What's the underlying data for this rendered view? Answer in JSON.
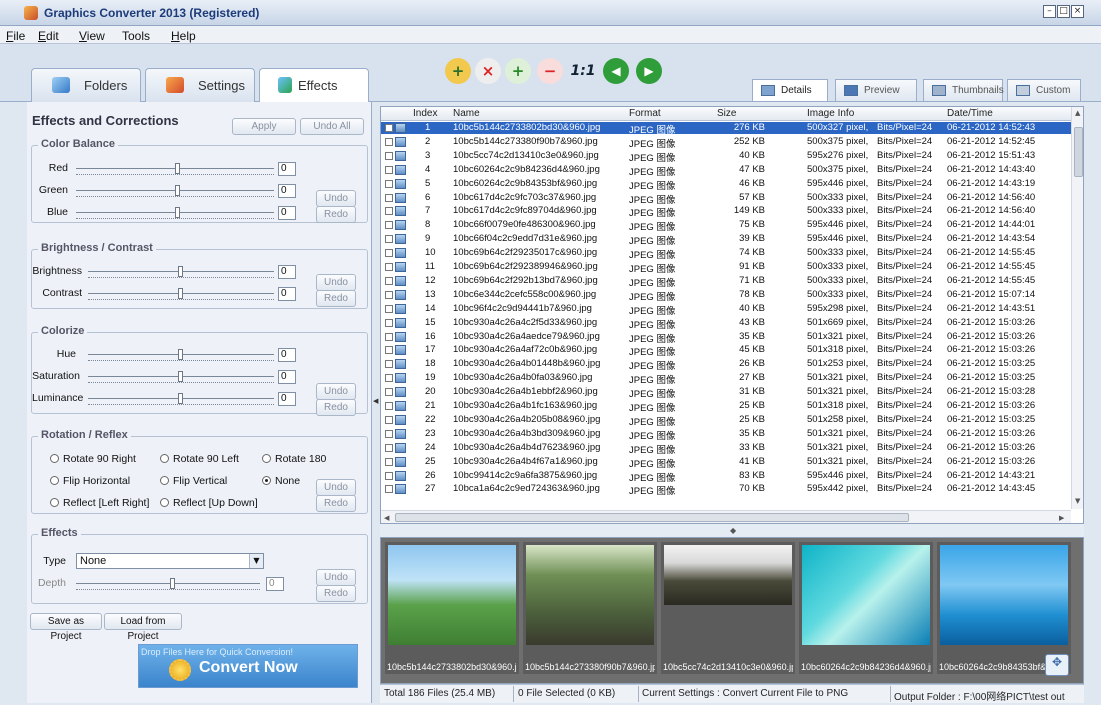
{
  "window": {
    "title": "Graphics Converter 2013  (Registered)"
  },
  "menu": [
    {
      "label": "File",
      "ul": "F",
      "rest": "ile"
    },
    {
      "label": "Edit",
      "ul": "E",
      "rest": "dit"
    },
    {
      "label": "View",
      "ul": "V",
      "rest": "iew"
    },
    {
      "label": "Tools",
      "ul": "",
      "rest": "Tools"
    },
    {
      "label": "Help",
      "ul": "H",
      "rest": "elp"
    }
  ],
  "main_tabs": [
    "Folders",
    "Settings",
    "Effects"
  ],
  "toolbar": {
    "one_to_one": "1:1"
  },
  "view_tabs": [
    "Details",
    "Preview",
    "Thumbnails",
    "Custom"
  ],
  "panel": {
    "title": "Effects and Corrections",
    "apply": "Apply",
    "undo_all": "Undo All",
    "undo": "Undo",
    "redo": "Redo",
    "color_balance": {
      "title": "Color Balance",
      "red": "Red",
      "green": "Green",
      "blue": "Blue",
      "red_value": "0",
      "green_value": "0",
      "blue_value": "0"
    },
    "brightness": {
      "title": "Brightness / Contrast",
      "brightness": "Brightness",
      "contrast": "Contrast",
      "brightness_value": "0",
      "contrast_value": "0"
    },
    "colorize": {
      "title": "Colorize",
      "hue": "Hue",
      "saturation": "Saturation",
      "luminance": "Luminance",
      "hue_value": "0",
      "saturation_value": "0",
      "luminance_value": "0"
    },
    "rotation": {
      "title": "Rotation / Reflex",
      "options": [
        "Rotate 90 Right",
        "Rotate 90 Left",
        "Rotate 180",
        "Flip Horizontal",
        "Flip Vertical",
        "None",
        "Reflect [Left Right]",
        "Reflect [Up Down]"
      ],
      "selected": "None"
    },
    "effects": {
      "title": "Effects",
      "type_label": "Type",
      "type_value": "None",
      "depth_label": "Depth",
      "depth_value": "0"
    },
    "save_project": "Save as Project",
    "load_project": "Load from Project",
    "convert_hint": "Drop Files Here for Quick Conversion!",
    "convert_now": "Convert Now"
  },
  "file_list": {
    "columns": [
      "Index",
      "Name",
      "Format",
      "Size",
      "Image Info",
      "Date/Time"
    ],
    "rows": [
      [
        "1",
        "10bc5b144c2733802bd30&960.jpg",
        "JPEG 图像",
        "276 KB",
        "500x327 pixel,",
        "Bits/Pixel=24",
        "06-21-2012  14:52:43"
      ],
      [
        "2",
        "10bc5b144c273380f90b7&960.jpg",
        "JPEG 图像",
        "252 KB",
        "500x375 pixel,",
        "Bits/Pixel=24",
        "06-21-2012  14:52:45"
      ],
      [
        "3",
        "10bc5cc74c2d13410c3e0&960.jpg",
        "JPEG 图像",
        "40 KB",
        "595x276 pixel,",
        "Bits/Pixel=24",
        "06-21-2012  15:51:43"
      ],
      [
        "4",
        "10bc60264c2c9b84236d4&960.jpg",
        "JPEG 图像",
        "47 KB",
        "500x375 pixel,",
        "Bits/Pixel=24",
        "06-21-2012  14:43:40"
      ],
      [
        "5",
        "10bc60264c2c9b84353bf&960.jpg",
        "JPEG 图像",
        "46 KB",
        "595x446 pixel,",
        "Bits/Pixel=24",
        "06-21-2012  14:43:19"
      ],
      [
        "6",
        "10bc617d4c2c9fc703c37&960.jpg",
        "JPEG 图像",
        "57 KB",
        "500x333 pixel,",
        "Bits/Pixel=24",
        "06-21-2012  14:56:40"
      ],
      [
        "7",
        "10bc617d4c2c9fc89704d&960.jpg",
        "JPEG 图像",
        "149 KB",
        "500x333 pixel,",
        "Bits/Pixel=24",
        "06-21-2012  14:56:40"
      ],
      [
        "8",
        "10bc66f0079e0fe486300&960.jpg",
        "JPEG 图像",
        "75 KB",
        "595x446 pixel,",
        "Bits/Pixel=24",
        "06-21-2012  14:44:01"
      ],
      [
        "9",
        "10bc66f04c2c9edd7d31e&960.jpg",
        "JPEG 图像",
        "39 KB",
        "595x446 pixel,",
        "Bits/Pixel=24",
        "06-21-2012  14:43:54"
      ],
      [
        "10",
        "10bc69b64c2f29235017c&960.jpg",
        "JPEG 图像",
        "74 KB",
        "500x333 pixel,",
        "Bits/Pixel=24",
        "06-21-2012  14:55:45"
      ],
      [
        "11",
        "10bc69b64c2f292389946&960.jpg",
        "JPEG 图像",
        "91 KB",
        "500x333 pixel,",
        "Bits/Pixel=24",
        "06-21-2012  14:55:45"
      ],
      [
        "12",
        "10bc69b64c2f292b13bd7&960.jpg",
        "JPEG 图像",
        "71 KB",
        "500x333 pixel,",
        "Bits/Pixel=24",
        "06-21-2012  14:55:45"
      ],
      [
        "13",
        "10bc6e344c2cefc558c00&960.jpg",
        "JPEG 图像",
        "78 KB",
        "500x333 pixel,",
        "Bits/Pixel=24",
        "06-21-2012  15:07:14"
      ],
      [
        "14",
        "10bc96f4c2c9d94441b7&960.jpg",
        "JPEG 图像",
        "40 KB",
        "595x298 pixel,",
        "Bits/Pixel=24",
        "06-21-2012  14:43:51"
      ],
      [
        "15",
        "10bc930a4c26a4c2f5d33&960.jpg",
        "JPEG 图像",
        "43 KB",
        "501x669 pixel,",
        "Bits/Pixel=24",
        "06-21-2012  15:03:26"
      ],
      [
        "16",
        "10bc930a4c26a4aedce79&960.jpg",
        "JPEG 图像",
        "35 KB",
        "501x321 pixel,",
        "Bits/Pixel=24",
        "06-21-2012  15:03:26"
      ],
      [
        "17",
        "10bc930a4c26a4af72c0b&960.jpg",
        "JPEG 图像",
        "45 KB",
        "501x318 pixel,",
        "Bits/Pixel=24",
        "06-21-2012  15:03:26"
      ],
      [
        "18",
        "10bc930a4c26a4b01448b&960.jpg",
        "JPEG 图像",
        "26 KB",
        "501x253 pixel,",
        "Bits/Pixel=24",
        "06-21-2012  15:03:25"
      ],
      [
        "19",
        "10bc930a4c26a4b0fa03&960.jpg",
        "JPEG 图像",
        "27 KB",
        "501x321 pixel,",
        "Bits/Pixel=24",
        "06-21-2012  15:03:25"
      ],
      [
        "20",
        "10bc930a4c26a4b1ebbf2&960.jpg",
        "JPEG 图像",
        "31 KB",
        "501x321 pixel,",
        "Bits/Pixel=24",
        "06-21-2012  15:03:28"
      ],
      [
        "21",
        "10bc930a4c26a4b1fc163&960.jpg",
        "JPEG 图像",
        "25 KB",
        "501x318 pixel,",
        "Bits/Pixel=24",
        "06-21-2012  15:03:26"
      ],
      [
        "22",
        "10bc930a4c26a4b205b08&960.jpg",
        "JPEG 图像",
        "25 KB",
        "501x258 pixel,",
        "Bits/Pixel=24",
        "06-21-2012  15:03:25"
      ],
      [
        "23",
        "10bc930a4c26a4b3bd309&960.jpg",
        "JPEG 图像",
        "35 KB",
        "501x321 pixel,",
        "Bits/Pixel=24",
        "06-21-2012  15:03:26"
      ],
      [
        "24",
        "10bc930a4c26a4b4d7623&960.jpg",
        "JPEG 图像",
        "33 KB",
        "501x321 pixel,",
        "Bits/Pixel=24",
        "06-21-2012  15:03:26"
      ],
      [
        "25",
        "10bc930a4c26a4b4f67a1&960.jpg",
        "JPEG 图像",
        "41 KB",
        "501x321 pixel,",
        "Bits/Pixel=24",
        "06-21-2012  15:03:26"
      ],
      [
        "26",
        "10bc99414c2c9a6fa3875&960.jpg",
        "JPEG 图像",
        "83 KB",
        "595x446 pixel,",
        "Bits/Pixel=24",
        "06-21-2012  14:43:21"
      ],
      [
        "27",
        "10bca1a64c2c9ed724363&960.jpg",
        "JPEG 图像",
        "70 KB",
        "595x442 pixel,",
        "Bits/Pixel=24",
        "06-21-2012  14:43:45"
      ]
    ]
  },
  "thumbnails": [
    "10bc5b144c2733802bd30&960.jpg",
    "10bc5b144c273380f90b7&960.jpg",
    "10bc5cc74c2d13410c3e0&960.jpg",
    "10bc60264c2c9b84236d4&960.jpg",
    "10bc60264c2c9b84353bf&960.jpg"
  ],
  "status": {
    "total": "Total 186 Files (25.4 MB)",
    "selected": "0 File Selected (0 KB)",
    "settings": "Current Settings : Convert Current File to PNG",
    "output": "Output Folder : F:\\00网络PICT\\test out"
  }
}
